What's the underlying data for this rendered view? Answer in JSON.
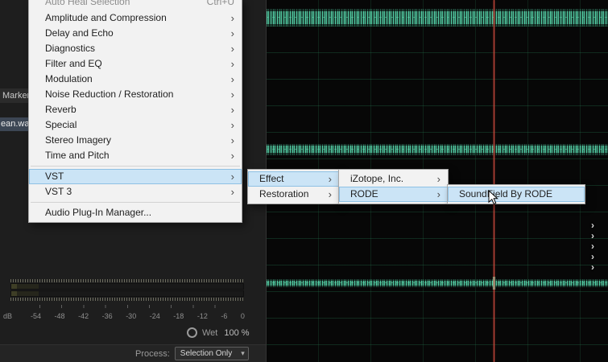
{
  "colors": {
    "menu_bg": "#f2f2f2",
    "menu_highlight": "#cbe4f6",
    "menu_highlight_border": "#8ec1e4",
    "waveform": "#56d7ac",
    "grid_line": "#267d52",
    "playhead": "#cf4a3d",
    "app_bg": "#1e1e1e",
    "editor_bg": "#070707"
  },
  "icons": {
    "submenu_arrow": "›",
    "dropdown_caret": "▾",
    "panel_chevron": "›"
  },
  "left_panel": {
    "markers_tab": "Markers",
    "selected_file": "ean.wav"
  },
  "effects_menu": {
    "clipped_item": {
      "label": "Auto Heal Selection",
      "shortcut": "Ctrl+U"
    },
    "items": [
      {
        "label": "Amplitude and Compression"
      },
      {
        "label": "Delay and Echo"
      },
      {
        "label": "Diagnostics"
      },
      {
        "label": "Filter and EQ"
      },
      {
        "label": "Modulation"
      },
      {
        "label": "Noise Reduction / Restoration"
      },
      {
        "label": "Reverb"
      },
      {
        "label": "Special"
      },
      {
        "label": "Stereo Imagery"
      },
      {
        "label": "Time and Pitch"
      }
    ],
    "vst_item": {
      "label": "VST"
    },
    "vst3_item": {
      "label": "VST 3"
    },
    "plugin_manager_item": {
      "label": "Audio Plug-In Manager..."
    }
  },
  "vst_submenu": {
    "items": [
      {
        "label": "Effect"
      },
      {
        "label": "Restoration"
      }
    ]
  },
  "effect_submenu": {
    "items": [
      {
        "label": "iZotope, Inc."
      },
      {
        "label": "RODE"
      }
    ]
  },
  "rode_submenu": {
    "items": [
      {
        "label": "SoundField By RODE"
      }
    ]
  },
  "meters": {
    "unit_label": "dB",
    "scale_ticks": [
      "-54",
      "-48",
      "-42",
      "-36",
      "-30",
      "-24",
      "-18",
      "-12",
      "-6",
      "0"
    ]
  },
  "wet_control": {
    "label": "Wet",
    "value": "100 %"
  },
  "process_bar": {
    "label": "Process:",
    "selected_option": "Selection Only"
  }
}
